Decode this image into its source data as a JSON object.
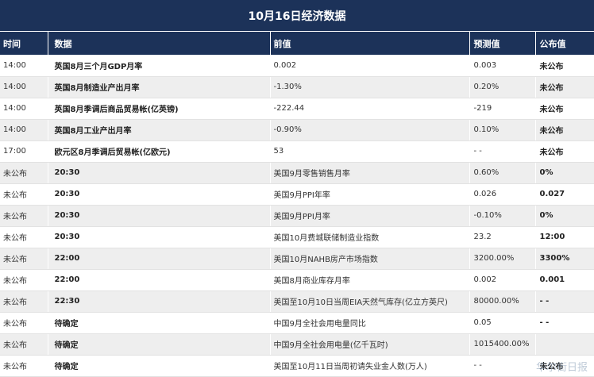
{
  "title": "10月16日经济数据",
  "columns": {
    "time": "时间",
    "data": "数据",
    "previous": "前值",
    "forecast": "预测值",
    "published": "公布值"
  },
  "rows": [
    {
      "time": "14:00",
      "data": "英国8月三个月GDP月率",
      "previous": "0.002",
      "forecast": "0.003",
      "published": "未公布"
    },
    {
      "time": "14:00",
      "data": "英国8月制造业产出月率",
      "previous": "-1.30%",
      "forecast": "0.20%",
      "published": "未公布"
    },
    {
      "time": "14:00",
      "data": "英国8月季调后商品贸易帐(亿英镑)",
      "previous": "-222.44",
      "forecast": "-219",
      "published": "未公布"
    },
    {
      "time": "14:00",
      "data": "英国8月工业产出月率",
      "previous": "-0.90%",
      "forecast": "0.10%",
      "published": "未公布"
    },
    {
      "time": "17:00",
      "data": "欧元区8月季调后贸易帐(亿欧元)",
      "previous": "53",
      "forecast": "- -",
      "published": "未公布"
    },
    {
      "time": "未公布",
      "data": "20:30",
      "previous": "美国9月零售销售月率",
      "forecast": "0.60%",
      "published": "0%"
    },
    {
      "time": "未公布",
      "data": "20:30",
      "previous": "美国9月PPI年率",
      "forecast": "0.026",
      "published": "0.027"
    },
    {
      "time": "未公布",
      "data": "20:30",
      "previous": "美国9月PPI月率",
      "forecast": "-0.10%",
      "published": "0%"
    },
    {
      "time": "未公布",
      "data": "20:30",
      "previous": "美国10月费城联储制造业指数",
      "forecast": "23.2",
      "published": "12:00"
    },
    {
      "time": "未公布",
      "data": "22:00",
      "previous": "美国10月NAHB房产市场指数",
      "forecast": "3200.00%",
      "published": "3300%"
    },
    {
      "time": "未公布",
      "data": "22:00",
      "previous": "美国8月商业库存月率",
      "forecast": "0.002",
      "published": "0.001"
    },
    {
      "time": "未公布",
      "data": "22:30",
      "previous": "美国至10月10日当周EIA天然气库存(亿立方英尺)",
      "forecast": "80000.00%",
      "published": "- -"
    },
    {
      "time": "未公布",
      "data": "待确定",
      "previous": "中国9月全社会用电量同比",
      "forecast": "0.05",
      "published": "- -"
    },
    {
      "time": "未公布",
      "data": "待确定",
      "previous": "中国9月全社会用电量(亿千瓦时)",
      "forecast": "1015400.00%",
      "published": ""
    },
    {
      "time": "未公布",
      "data": "待确定",
      "previous": "美国至10月11日当周初请失业金人数(万人)",
      "forecast": "- -",
      "published": "未公布"
    }
  ],
  "watermark": "华尔街日报"
}
